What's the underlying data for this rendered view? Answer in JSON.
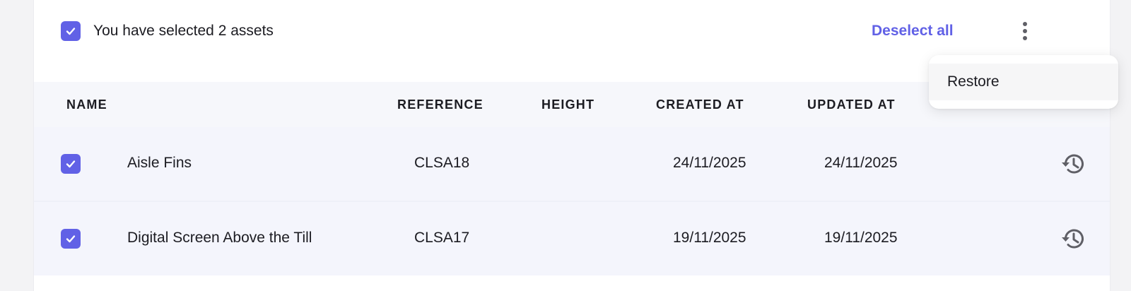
{
  "selection": {
    "text": "You have selected 2 assets",
    "deselect_label": "Deselect all",
    "menu_icon": "more-vertical-icon"
  },
  "menu": {
    "items": [
      {
        "label": "Restore"
      }
    ]
  },
  "table": {
    "columns": [
      "NAME",
      "REFERENCE",
      "HEIGHT",
      "CREATED AT",
      "UPDATED AT"
    ],
    "rows": [
      {
        "name": "Aisle Fins",
        "reference": "CLSA18",
        "height": "",
        "created_at": "24/11/2025",
        "updated_at": "24/11/2025",
        "checked": true,
        "action_icon": "restore-history-icon"
      },
      {
        "name": "Digital Screen Above the Till",
        "reference": "CLSA17",
        "height": "",
        "created_at": "19/11/2025",
        "updated_at": "19/11/2025",
        "checked": true,
        "action_icon": "restore-history-icon"
      }
    ]
  },
  "colors": {
    "accent": "#6161e6",
    "row_bg": "#f4f5fc",
    "header_bg": "#f6f7fb"
  }
}
